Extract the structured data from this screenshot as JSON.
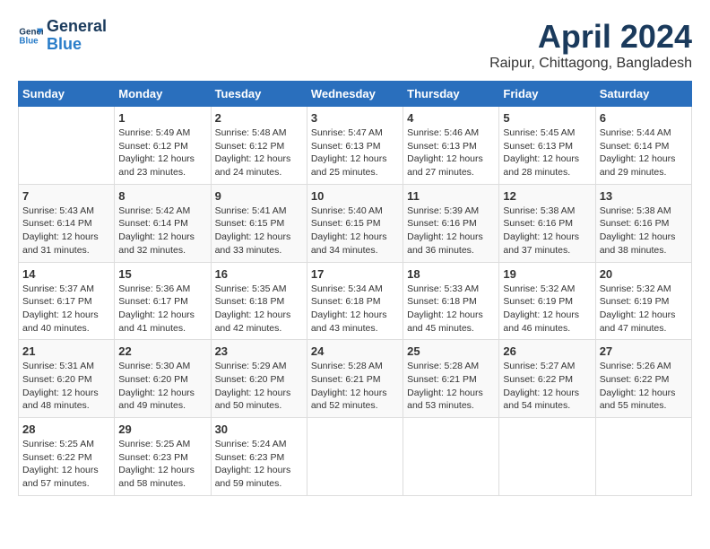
{
  "header": {
    "logo_line1": "General",
    "logo_line2": "Blue",
    "month_title": "April 2024",
    "location": "Raipur, Chittagong, Bangladesh"
  },
  "days_of_week": [
    "Sunday",
    "Monday",
    "Tuesday",
    "Wednesday",
    "Thursday",
    "Friday",
    "Saturday"
  ],
  "weeks": [
    [
      {
        "day": "",
        "info": ""
      },
      {
        "day": "1",
        "info": "Sunrise: 5:49 AM\nSunset: 6:12 PM\nDaylight: 12 hours\nand 23 minutes."
      },
      {
        "day": "2",
        "info": "Sunrise: 5:48 AM\nSunset: 6:12 PM\nDaylight: 12 hours\nand 24 minutes."
      },
      {
        "day": "3",
        "info": "Sunrise: 5:47 AM\nSunset: 6:13 PM\nDaylight: 12 hours\nand 25 minutes."
      },
      {
        "day": "4",
        "info": "Sunrise: 5:46 AM\nSunset: 6:13 PM\nDaylight: 12 hours\nand 27 minutes."
      },
      {
        "day": "5",
        "info": "Sunrise: 5:45 AM\nSunset: 6:13 PM\nDaylight: 12 hours\nand 28 minutes."
      },
      {
        "day": "6",
        "info": "Sunrise: 5:44 AM\nSunset: 6:14 PM\nDaylight: 12 hours\nand 29 minutes."
      }
    ],
    [
      {
        "day": "7",
        "info": "Sunrise: 5:43 AM\nSunset: 6:14 PM\nDaylight: 12 hours\nand 31 minutes."
      },
      {
        "day": "8",
        "info": "Sunrise: 5:42 AM\nSunset: 6:14 PM\nDaylight: 12 hours\nand 32 minutes."
      },
      {
        "day": "9",
        "info": "Sunrise: 5:41 AM\nSunset: 6:15 PM\nDaylight: 12 hours\nand 33 minutes."
      },
      {
        "day": "10",
        "info": "Sunrise: 5:40 AM\nSunset: 6:15 PM\nDaylight: 12 hours\nand 34 minutes."
      },
      {
        "day": "11",
        "info": "Sunrise: 5:39 AM\nSunset: 6:16 PM\nDaylight: 12 hours\nand 36 minutes."
      },
      {
        "day": "12",
        "info": "Sunrise: 5:38 AM\nSunset: 6:16 PM\nDaylight: 12 hours\nand 37 minutes."
      },
      {
        "day": "13",
        "info": "Sunrise: 5:38 AM\nSunset: 6:16 PM\nDaylight: 12 hours\nand 38 minutes."
      }
    ],
    [
      {
        "day": "14",
        "info": "Sunrise: 5:37 AM\nSunset: 6:17 PM\nDaylight: 12 hours\nand 40 minutes."
      },
      {
        "day": "15",
        "info": "Sunrise: 5:36 AM\nSunset: 6:17 PM\nDaylight: 12 hours\nand 41 minutes."
      },
      {
        "day": "16",
        "info": "Sunrise: 5:35 AM\nSunset: 6:18 PM\nDaylight: 12 hours\nand 42 minutes."
      },
      {
        "day": "17",
        "info": "Sunrise: 5:34 AM\nSunset: 6:18 PM\nDaylight: 12 hours\nand 43 minutes."
      },
      {
        "day": "18",
        "info": "Sunrise: 5:33 AM\nSunset: 6:18 PM\nDaylight: 12 hours\nand 45 minutes."
      },
      {
        "day": "19",
        "info": "Sunrise: 5:32 AM\nSunset: 6:19 PM\nDaylight: 12 hours\nand 46 minutes."
      },
      {
        "day": "20",
        "info": "Sunrise: 5:32 AM\nSunset: 6:19 PM\nDaylight: 12 hours\nand 47 minutes."
      }
    ],
    [
      {
        "day": "21",
        "info": "Sunrise: 5:31 AM\nSunset: 6:20 PM\nDaylight: 12 hours\nand 48 minutes."
      },
      {
        "day": "22",
        "info": "Sunrise: 5:30 AM\nSunset: 6:20 PM\nDaylight: 12 hours\nand 49 minutes."
      },
      {
        "day": "23",
        "info": "Sunrise: 5:29 AM\nSunset: 6:20 PM\nDaylight: 12 hours\nand 50 minutes."
      },
      {
        "day": "24",
        "info": "Sunrise: 5:28 AM\nSunset: 6:21 PM\nDaylight: 12 hours\nand 52 minutes."
      },
      {
        "day": "25",
        "info": "Sunrise: 5:28 AM\nSunset: 6:21 PM\nDaylight: 12 hours\nand 53 minutes."
      },
      {
        "day": "26",
        "info": "Sunrise: 5:27 AM\nSunset: 6:22 PM\nDaylight: 12 hours\nand 54 minutes."
      },
      {
        "day": "27",
        "info": "Sunrise: 5:26 AM\nSunset: 6:22 PM\nDaylight: 12 hours\nand 55 minutes."
      }
    ],
    [
      {
        "day": "28",
        "info": "Sunrise: 5:25 AM\nSunset: 6:22 PM\nDaylight: 12 hours\nand 57 minutes."
      },
      {
        "day": "29",
        "info": "Sunrise: 5:25 AM\nSunset: 6:23 PM\nDaylight: 12 hours\nand 58 minutes."
      },
      {
        "day": "30",
        "info": "Sunrise: 5:24 AM\nSunset: 6:23 PM\nDaylight: 12 hours\nand 59 minutes."
      },
      {
        "day": "",
        "info": ""
      },
      {
        "day": "",
        "info": ""
      },
      {
        "day": "",
        "info": ""
      },
      {
        "day": "",
        "info": ""
      }
    ]
  ]
}
